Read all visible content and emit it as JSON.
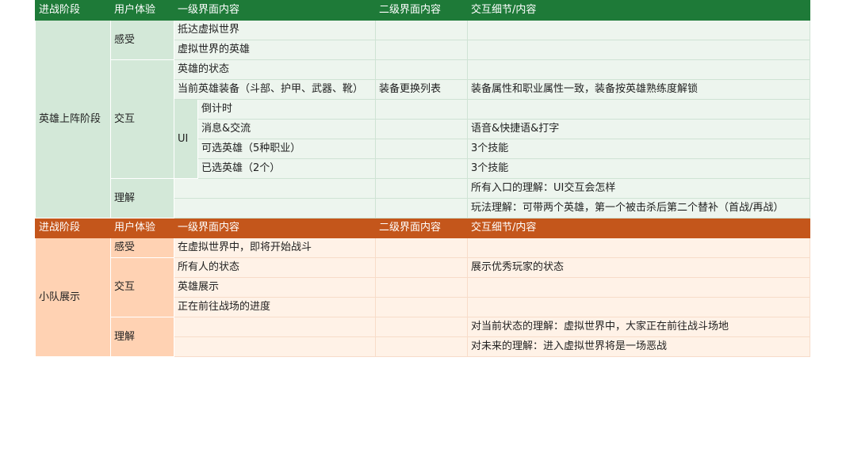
{
  "section1": {
    "headers": [
      "进战阶段",
      "用户体验",
      "一级界面内容",
      "二级界面内容",
      "交互细节/内容"
    ],
    "stage": "英雄上阵阶段",
    "ux": [
      "感受",
      "交互",
      "理解"
    ],
    "ui_label": "UI",
    "rows": [
      {
        "l1": "抵达虚拟世界",
        "l2": "",
        "detail": ""
      },
      {
        "l1": "虚拟世界的英雄",
        "l2": "",
        "detail": ""
      },
      {
        "l1": "英雄的状态",
        "l2": "",
        "detail": ""
      },
      {
        "l1": "当前英雄装备（斗部、护甲、武器、靴）",
        "l2": "装备更换列表",
        "detail": "装备属性和职业属性一致，装备按英雄熟练度解锁"
      },
      {
        "l1": "倒计时",
        "l2": "",
        "detail": ""
      },
      {
        "l1": "消息&交流",
        "l2": "",
        "detail": "语音&快捷语&打字"
      },
      {
        "l1": "可选英雄（5种职业）",
        "l2": "",
        "detail": "3个技能"
      },
      {
        "l1": "已选英雄（2个）",
        "l2": "",
        "detail": "3个技能"
      },
      {
        "l1": "",
        "l2": "",
        "detail": "所有入口的理解：UI交互会怎样"
      },
      {
        "l1": "",
        "l2": "",
        "detail": "玩法理解：可带两个英雄，第一个被击杀后第二个替补（首战/再战）"
      }
    ]
  },
  "section2": {
    "headers": [
      "进战阶段",
      "用户体验",
      "一级界面内容",
      "二级界面内容",
      "交互细节/内容"
    ],
    "stage": "小队展示",
    "ux": [
      "感受",
      "交互",
      "理解"
    ],
    "rows": [
      {
        "l1": "在虚拟世界中，即将开始战斗",
        "l2": "",
        "detail": ""
      },
      {
        "l1": "所有人的状态",
        "l2": "",
        "detail": "展示优秀玩家的状态"
      },
      {
        "l1": "英雄展示",
        "l2": "",
        "detail": ""
      },
      {
        "l1": "正在前往战场的进度",
        "l2": "",
        "detail": ""
      },
      {
        "l1": "",
        "l2": "",
        "detail": "对当前状态的理解：虚拟世界中，大家正在前往战斗场地"
      },
      {
        "l1": "",
        "l2": "",
        "detail": "对未来的理解：进入虚拟世界将是一场恶战"
      }
    ]
  }
}
